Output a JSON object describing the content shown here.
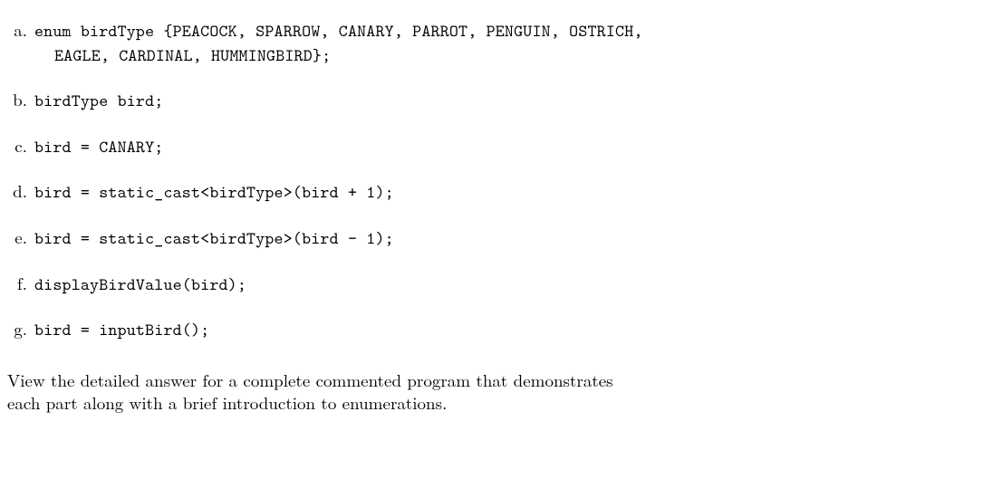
{
  "items": [
    {
      "marker": "a.",
      "code_line1": "enum birdType {PEACOCK, SPARROW, CANARY, PARROT, PENGUIN, OSTRICH,",
      "code_line2": "EAGLE, CARDINAL, HUMMINGBIRD};"
    },
    {
      "marker": "b.",
      "code_line1": "birdType bird;",
      "code_line2": ""
    },
    {
      "marker": "c.",
      "code_line1": "bird = CANARY;",
      "code_line2": ""
    },
    {
      "marker": "d.",
      "code_line1": "bird = static_cast<birdType>(bird + 1);",
      "code_line2": ""
    },
    {
      "marker": "e.",
      "code_line1": "bird = static_cast<birdType>(bird - 1);",
      "code_line2": ""
    },
    {
      "marker": "f.",
      "code_line1": "displayBirdValue(bird);",
      "code_line2": ""
    },
    {
      "marker": "g.",
      "code_line1": "bird = inputBird();",
      "code_line2": ""
    }
  ],
  "footer": {
    "line1": "View the detailed answer for a complete commented program that demonstrates",
    "line2": "each part along with a brief introduction to enumerations."
  }
}
